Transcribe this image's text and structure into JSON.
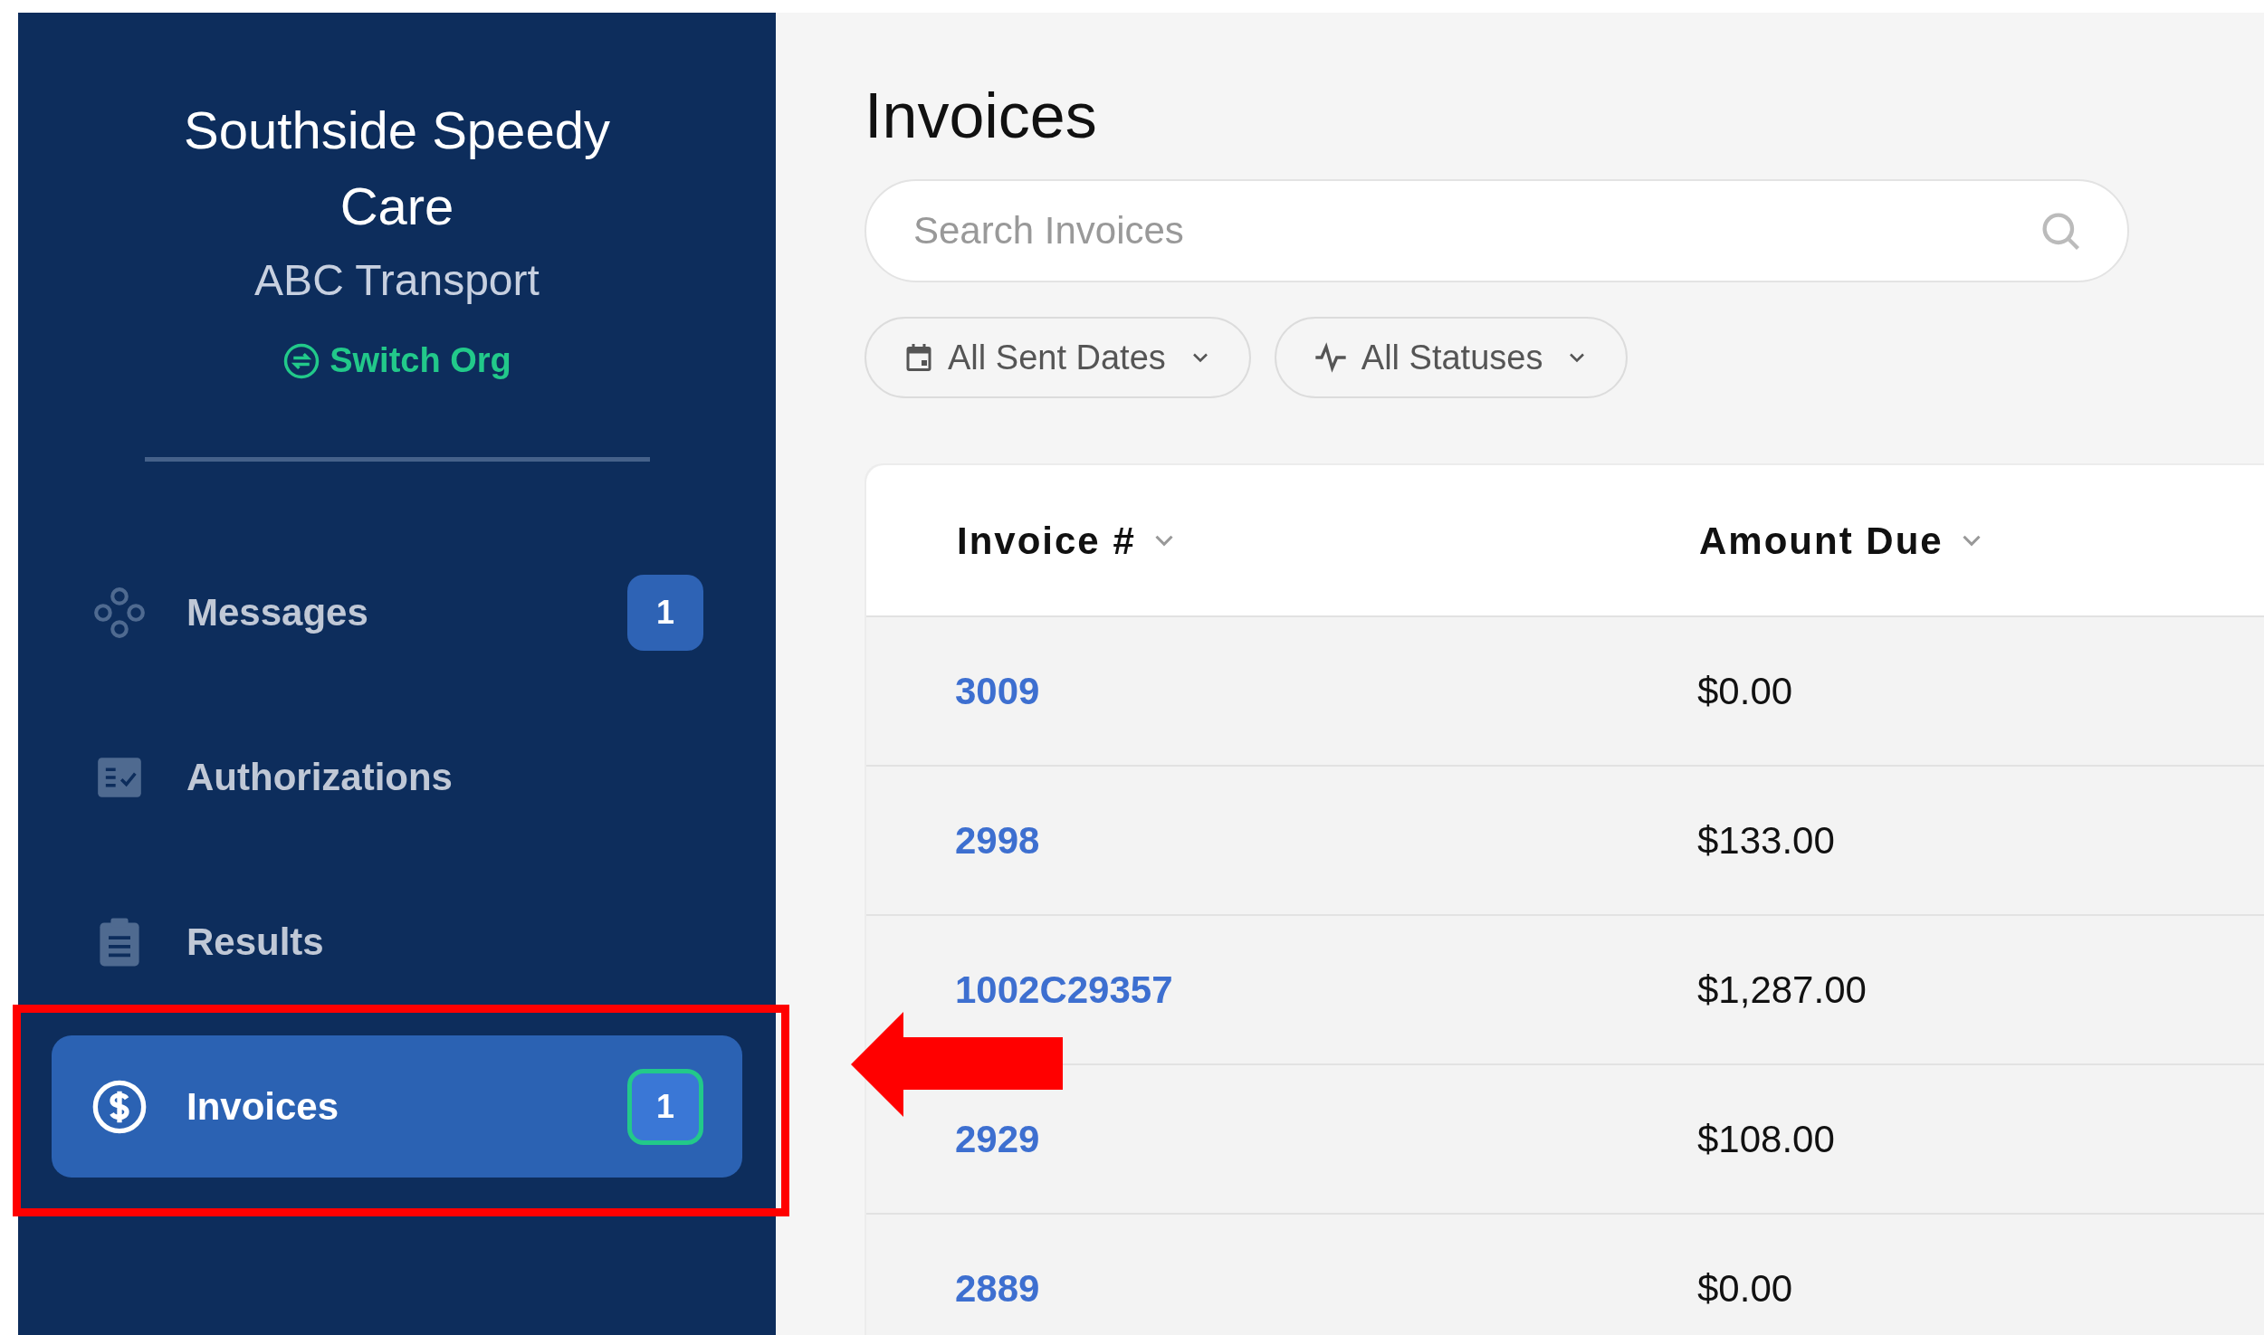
{
  "sidebar": {
    "org_name": "Southside Speedy Care",
    "company": "ABC Transport",
    "switch_link": "Switch Org",
    "items": [
      {
        "label": "Messages",
        "badge": "1",
        "selected": false
      },
      {
        "label": "Authorizations",
        "selected": false
      },
      {
        "label": "Results",
        "selected": false
      },
      {
        "label": "Invoices",
        "badge": "1",
        "selected": true
      }
    ]
  },
  "main": {
    "title": "Invoices",
    "search": {
      "placeholder": "Search Invoices"
    },
    "filters": [
      {
        "label": "All Sent Dates",
        "kind": "date"
      },
      {
        "label": "All Statuses",
        "kind": "status"
      }
    ],
    "table": {
      "columns": [
        "Invoice #",
        "Amount Due"
      ],
      "rows": [
        {
          "invoice": "3009",
          "amount": "$0.00"
        },
        {
          "invoice": "2998",
          "amount": "$133.00"
        },
        {
          "invoice": "1002C29357",
          "amount": "$1,287.00"
        },
        {
          "invoice": "2929",
          "amount": "$108.00"
        },
        {
          "invoice": "2889",
          "amount": "$0.00"
        }
      ]
    }
  },
  "annotations": [
    {
      "kind": "highlight_box"
    },
    {
      "kind": "arrow"
    }
  ]
}
